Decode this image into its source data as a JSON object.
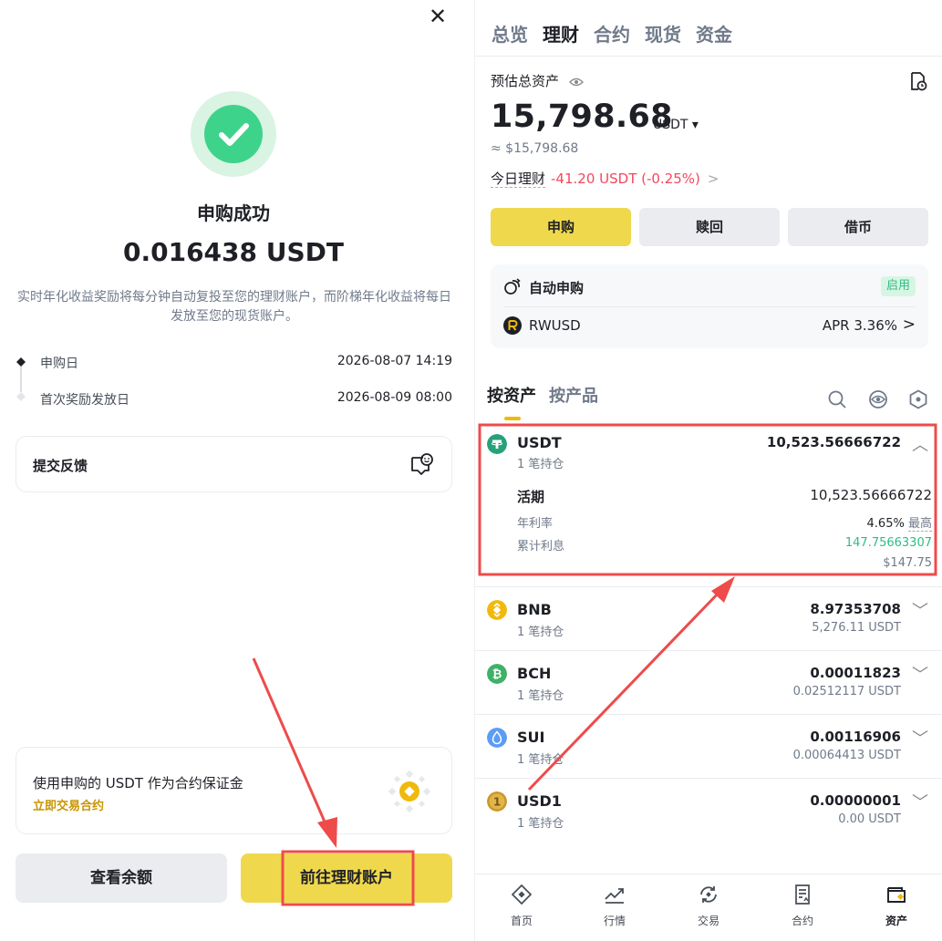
{
  "left": {
    "close_label": "✕",
    "title": "申购成功",
    "amount": "0.016438 USDT",
    "description": "实时年化收益奖励将每分钟自动复投至您的理财账户，而阶梯年化收益将每日发放至您的现货账户。",
    "timeline": [
      {
        "label": "申购日",
        "value": "2026-08-07 14:19"
      },
      {
        "label": "首次奖励发放日",
        "value": "2026-08-09 08:00"
      }
    ],
    "feedback_label": "提交反馈",
    "promo_text": "使用申购的 USDT 作为合约保证金",
    "promo_link": "立即交易合约",
    "btn_balance": "查看余额",
    "btn_goto": "前往理财账户"
  },
  "right": {
    "tabs": [
      "总览",
      "理财",
      "合约",
      "现货",
      "资金"
    ],
    "active_tab": "理财",
    "estimated_label": "预估总资产",
    "total_amount": "15,798.68",
    "total_unit": "USDT ▾",
    "total_usd": "≈ $15,798.68",
    "today_label": "今日理财",
    "today_pnl": "-41.20 USDT (-0.25%)",
    "today_chevron": ">",
    "actions": [
      "申购",
      "赎回",
      "借币"
    ],
    "auto_subscribe": {
      "title": "自动申购",
      "badge": "启用",
      "coin": "RWUSD",
      "apr": "APR 3.36%",
      "chevron": ">"
    },
    "subtabs": [
      "按资产",
      "按产品"
    ],
    "assets": [
      {
        "symbol": "USDT",
        "positions": "1 笔持仓",
        "amount": "10,523.56666722",
        "value": "",
        "color": "#26a17b"
      },
      {
        "symbol": "BNB",
        "positions": "1 笔持仓",
        "amount": "8.97353708",
        "value": "5,276.11 USDT",
        "color": "#f0b90b"
      },
      {
        "symbol": "BCH",
        "positions": "1 笔持仓",
        "amount": "0.00011823",
        "value": "0.02512117 USDT",
        "color": "#3fb068"
      },
      {
        "symbol": "SUI",
        "positions": "1 笔持仓",
        "amount": "0.00116906",
        "value": "0.00064413 USDT",
        "color": "#5b9cf5"
      },
      {
        "symbol": "USD1",
        "positions": "1 笔持仓",
        "amount": "0.00000001",
        "value": "0.00 USDT",
        "color": "#c9962a"
      }
    ],
    "usdt_detail": {
      "product": "活期",
      "product_amount": "10,523.56666722",
      "rate_label": "年利率",
      "rate_value": "4.65%",
      "rate_suffix": "最高",
      "interest_label": "累计利息",
      "interest_value": "147.75663307",
      "interest_usd": "$147.75"
    },
    "nav": [
      "首页",
      "行情",
      "交易",
      "合约",
      "资产"
    ]
  },
  "colors": {
    "accent_yellow": "#f0d84d",
    "success_green": "#3ed38b",
    "loss_red": "#f6465d",
    "gain_green": "#2ebd85",
    "annotation_red": "#ee4b4b"
  }
}
